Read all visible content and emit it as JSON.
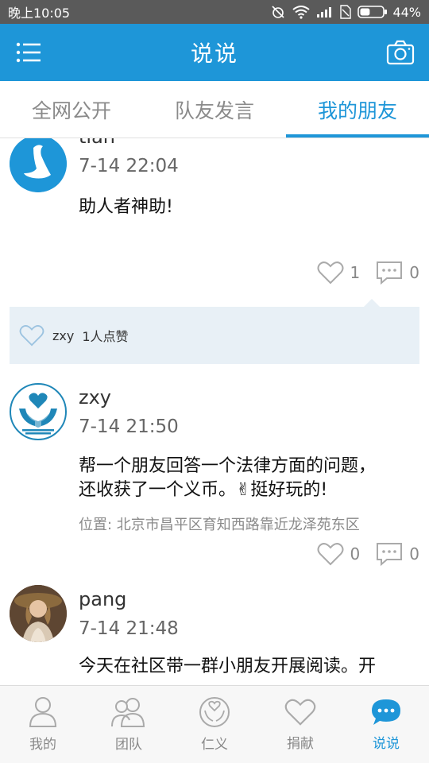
{
  "status_bar": {
    "time": "晚上10:05",
    "battery_percent": "44%",
    "battery_level": 0.44
  },
  "app_bar": {
    "title": "说说",
    "menu_icon": "menu-icon",
    "camera_icon": "camera-icon"
  },
  "tabs": [
    {
      "label": "全网公开",
      "active": false
    },
    {
      "label": "队友发言",
      "active": false
    },
    {
      "label": "我的朋友",
      "active": true
    }
  ],
  "posts": [
    {
      "user": "tian",
      "time": "7-14 22:04",
      "text": "助人者神助!",
      "location": "",
      "likes": "1",
      "comments": "0",
      "liked_by": {
        "users": "zxy",
        "summary": "1人点赞"
      }
    },
    {
      "user": "zxy",
      "time": "7-14 21:50",
      "text_line1": "帮一个朋友回答一个法律方面的问题，",
      "text_line2": "还收获了一个义币。✌挺好玩的!",
      "location": "位置: 北京市昌平区育知西路靠近龙泽苑东区",
      "likes": "0",
      "comments": "0"
    },
    {
      "user": "pang",
      "time": "7-14 21:48",
      "text": "今天在社区带一群小朋友开展阅读。开"
    }
  ],
  "bottom_nav": [
    {
      "label": "我的",
      "icon": "person-icon",
      "active": false
    },
    {
      "label": "团队",
      "icon": "team-icon",
      "active": false
    },
    {
      "label": "仁义",
      "icon": "charity-logo-icon",
      "active": false
    },
    {
      "label": "捐献",
      "icon": "heart-icon",
      "active": false
    },
    {
      "label": "说说",
      "icon": "chat-bubble-icon",
      "active": true
    }
  ],
  "colors": {
    "brand": "#1e96d8",
    "status_bar": "#5a5a5a",
    "like_box": "#e8f0f6"
  }
}
